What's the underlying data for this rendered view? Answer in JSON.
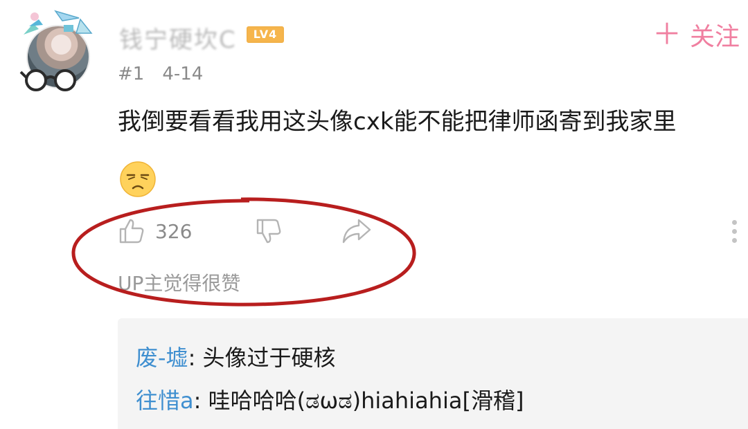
{
  "comment": {
    "user": {
      "name": "钱宁硬坎C",
      "level": "LV4",
      "avatar": "avatar-image",
      "follow_label": "关注",
      "follow_icon": "plus-icon"
    },
    "floor": "#1",
    "date": "4-14",
    "text": "我倒要看看我用这头像cxk能不能把律师函寄到我家里",
    "emoji": "smug-emoji",
    "like_count": "326",
    "up_liked": "UP主觉得很赞",
    "annotation_color": "#b81e1e"
  },
  "replies": [
    {
      "name": "废-墟",
      "separator": ": ",
      "text": "头像过于硬核"
    },
    {
      "name": "往惜a",
      "separator": ": ",
      "text": "哇哈哈哈(ಡωಡ)hiahiahia[滑稽]"
    }
  ],
  "colors": {
    "follow": "#f07fa0",
    "reply_name": "#3f8fd0",
    "level_badge": "#f6b54c"
  }
}
